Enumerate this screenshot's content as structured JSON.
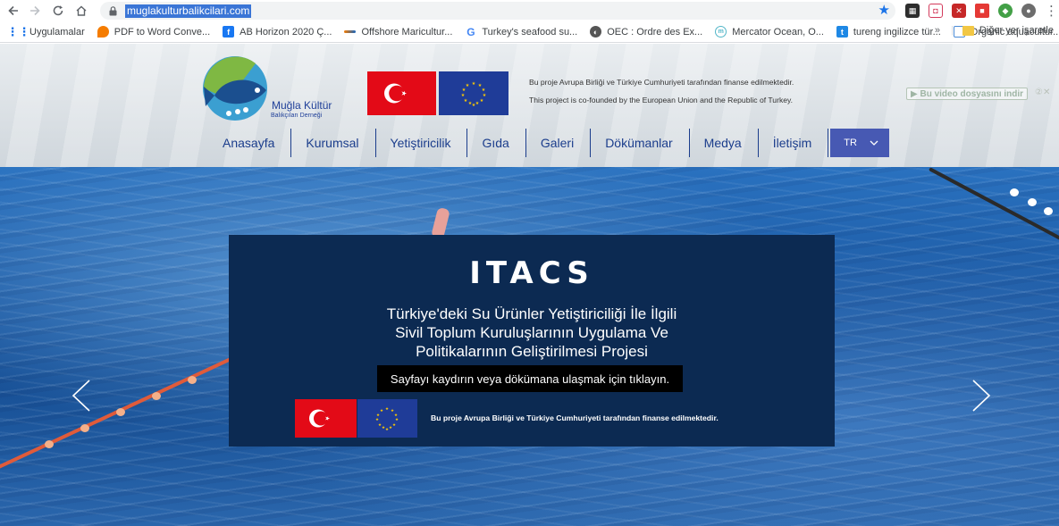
{
  "browser": {
    "url": "muglakulturbalikcilari.com",
    "bookmarks": [
      {
        "label": "Uygulamalar",
        "icon": "apps-grid-icon",
        "color": "#1a73e8"
      },
      {
        "label": "PDF to Word Conve...",
        "icon": "pdf-converter-icon",
        "color": "#f57c00"
      },
      {
        "label": "AB Horizon 2020 Ç...",
        "icon": "facebook-icon",
        "color": "#1877f2"
      },
      {
        "label": "Offshore Maricultur...",
        "icon": "offshore-icon",
        "color": "#ef6c00"
      },
      {
        "label": "Turkey's seafood su...",
        "icon": "google-icon",
        "color": "#4285f4"
      },
      {
        "label": "OEC : Ordre des Ex...",
        "icon": "oec-icon",
        "color": "#555555"
      },
      {
        "label": "Mercator Ocean, O...",
        "icon": "mercator-icon",
        "color": "#52b6c8"
      },
      {
        "label": "tureng ingilizce tür...",
        "icon": "tureng-icon",
        "color": "#1e88e5"
      },
      {
        "label": "Organic aquacultur...",
        "icon": "organic-icon",
        "color": "#4b8bd6"
      }
    ],
    "bookmarks_overflow": "»",
    "other_bookmarks": "Diğer yer işaretle"
  },
  "header": {
    "logo_title": "Muğla Kültür",
    "logo_subtitle": "Balıkçıları Derneği",
    "info_tr": "Bu proje Avrupa Birliği ve Türkiye Cumhuriyeti tarafından finanse edilmektedir.",
    "info_en": "This project is co-founded by the European Union and the Republic of Turkey.",
    "video_download": "▶ Bu video dosyasını indir",
    "video_download_extra": "②✕",
    "menu": [
      "Anasayfa",
      "Kurumsal",
      "Yetiştiricilik",
      "Gıda",
      "Galeri",
      "Dökümanlar",
      "Medya",
      "İletişim"
    ],
    "lang": "TR",
    "lang_color": "#4759b3",
    "menu_color": "#1b3d8c"
  },
  "hero": {
    "title": "ITACS",
    "body_lines": [
      "Türkiye'deki Su Ürünler Yetiştiriciliği İle İlgili",
      "Sivil Toplum Kuruluşlarının Uygulama Ve",
      "Politikalarının Geliştirilmesi Projesi"
    ],
    "cta": "Sayfayı kaydırın veya dökümana ulaşmak için tıklayın.",
    "note": "Bu proje Avrupa Birliği ve Türkiye Cumhuriyeti tarafından finanse edilmektedir.",
    "panel_color": "#0c2a52"
  }
}
